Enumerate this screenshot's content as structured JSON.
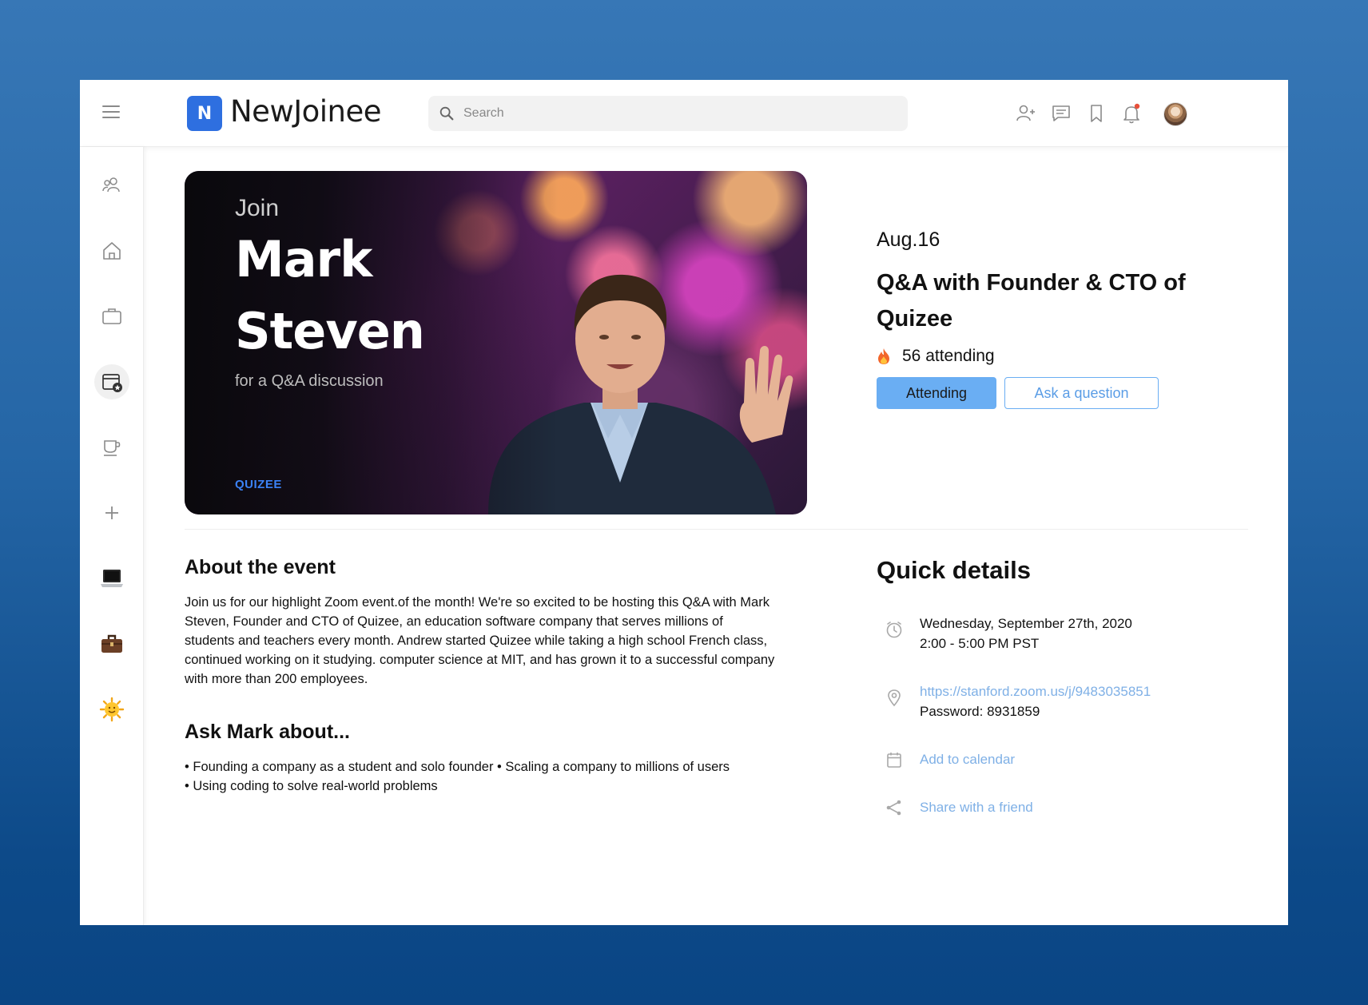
{
  "app": {
    "name": "NewJoinee",
    "logo_glyph": "N"
  },
  "search": {
    "placeholder": "Search"
  },
  "header_icons": [
    "add-user-icon",
    "message-icon",
    "bookmark-icon",
    "bell-icon",
    "avatar"
  ],
  "sidebar": {
    "items": [
      "people-icon",
      "home-icon",
      "briefcase-outline-icon",
      "calendar-star-icon",
      "coffee-cup-icon",
      "plus-icon",
      "laptop-emoji-icon",
      "briefcase-emoji-icon",
      "sun-emoji-icon"
    ],
    "active": "calendar-star-icon"
  },
  "hero": {
    "join": "Join",
    "first_name": "Mark",
    "last_name": "Steven",
    "subtitle": "for a Q&A discussion",
    "brand": "QUIZEE"
  },
  "event": {
    "date": "Aug.16",
    "title": "Q&A with Founder & CTO of Quizee",
    "attending": "56 attending",
    "attending_button": "Attending",
    "ask_button": "Ask a question"
  },
  "about": {
    "heading": "About the event",
    "body": "Join us for our highlight Zoom event.of the month! We're so excited to be hosting this Q&A with Mark Steven, Founder and CTO of Quizee, an education software company that serves millions of students and teachers every month. Andrew started Quizee while taking a high school French class, continued working on it studying. computer science at MIT, and has grown it to a successful company with more than 200 employees."
  },
  "ask": {
    "heading": "Ask Mark about...",
    "line1": "• Founding a company as a student and solo founder • Scaling a company to millions of users",
    "line2": "• Using coding to solve real-world problems"
  },
  "quick_details": {
    "heading": "Quick details",
    "datetime_line1": "Wednesday, September 27th, 2020",
    "datetime_line2": "2:00 - 5:00 PM PST",
    "zoom_link": "https://stanford.zoom.us/j/9483035851",
    "password": "Password: 8931859",
    "add_calendar": "Add to calendar",
    "share": "Share with a friend"
  },
  "colors": {
    "accent": "#6aaef3",
    "link": "#7fb0e6",
    "logo": "#2e6fe0",
    "brand": "#3b82f6",
    "notification_dot": "#e8503a"
  }
}
